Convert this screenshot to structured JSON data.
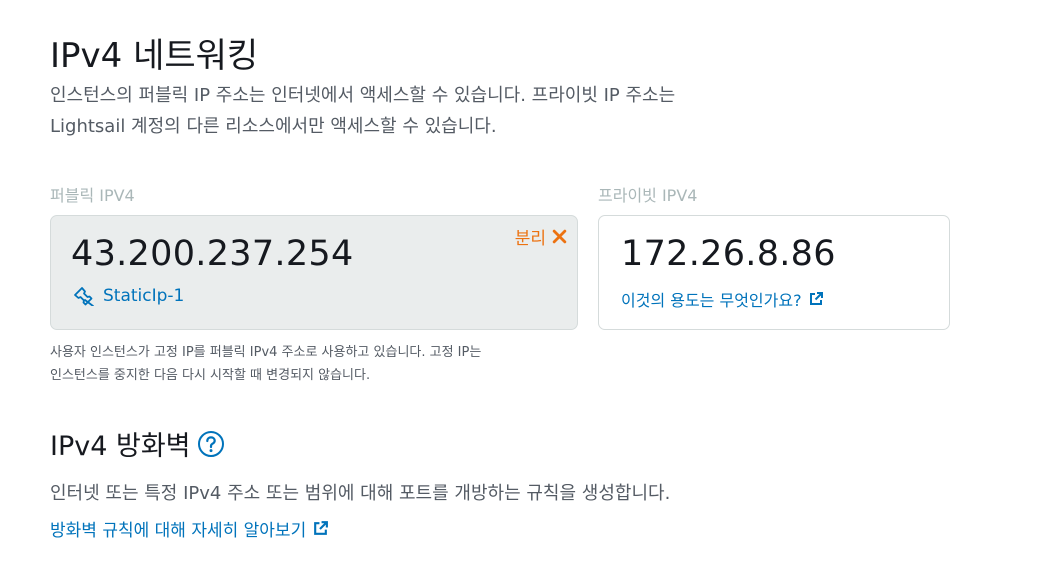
{
  "networking": {
    "title": "IPv4 네트워킹",
    "description_line1": "인스턴스의 퍼블릭 IP 주소는 인터넷에서 액세스할 수 있습니다. 프라이빗 IP 주소는",
    "description_line2": "Lightsail 계정의 다른 리소스에서만 액세스할 수 있습니다.",
    "public": {
      "label": "퍼블릭 IPV4",
      "ip": "43.200.237.254",
      "static_ip_name": "StaticIp-1",
      "detach_label": "분리"
    },
    "private": {
      "label": "프라이빗 IPV4",
      "ip": "172.26.8.86",
      "help_link": "이것의 용도는 무엇인가요?"
    },
    "note_line1": "사용자 인스턴스가 고정 IP를 퍼블릭 IPv4 주소로 사용하고 있습니다. 고정 IP는",
    "note_line2": "인스턴스를 중지한 다음 다시 시작할 때 변경되지 않습니다."
  },
  "firewall": {
    "title": "IPv4 방화벽",
    "description": "인터넷 또는 특정 IPv4 주소 또는 범위에 대해 포트를 개방하는 규칙을 생성합니다.",
    "learn_link": "방화벽 규칙에 대해 자세히 알아보기"
  },
  "icons": {
    "static_ip": "pin-icon",
    "detach": "close-icon",
    "external": "external-link-icon",
    "help": "help-circle-icon"
  },
  "colors": {
    "link": "#0073bb",
    "detach": "#ec7211",
    "public_box_bg": "#eaeded"
  }
}
